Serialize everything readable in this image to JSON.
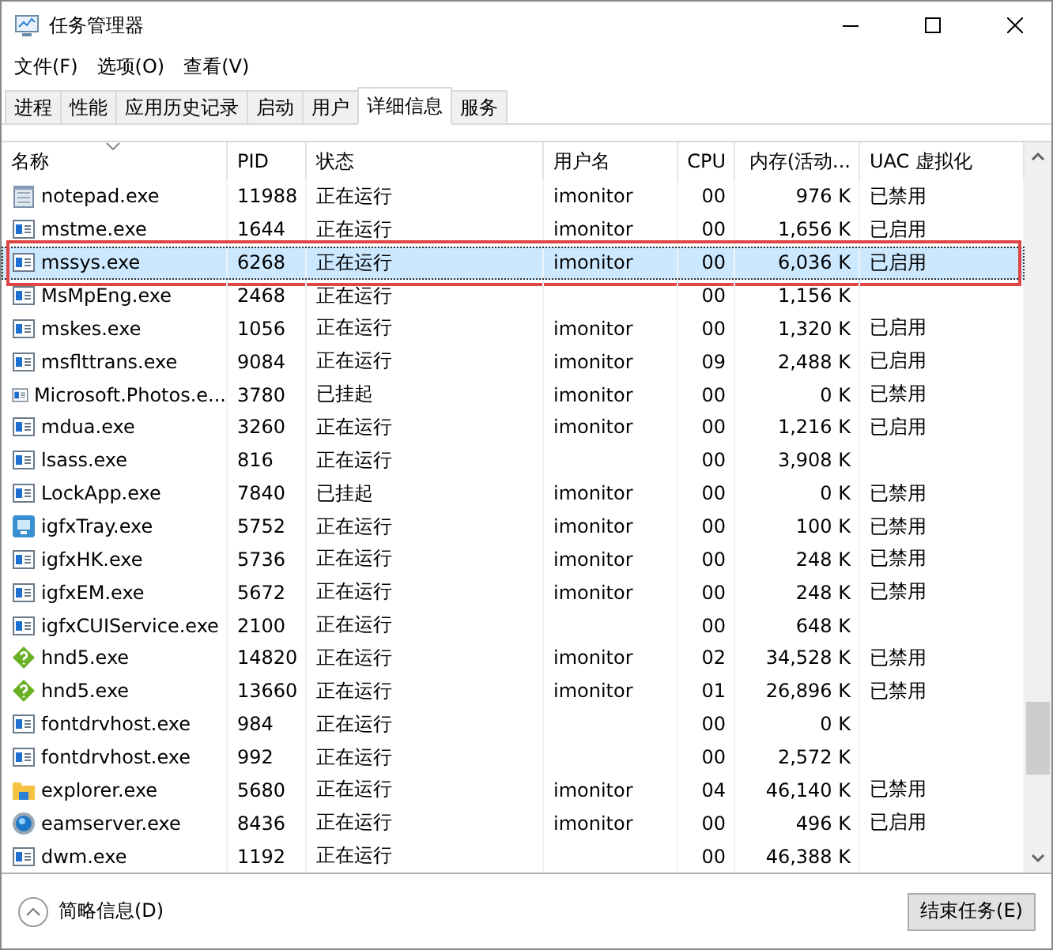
{
  "window": {
    "title": "任务管理器"
  },
  "menu": [
    "文件(F)",
    "选项(O)",
    "查看(V)"
  ],
  "tabs": [
    {
      "label": "进程",
      "selected": false
    },
    {
      "label": "性能",
      "selected": false
    },
    {
      "label": "应用历史记录",
      "selected": false
    },
    {
      "label": "启动",
      "selected": false
    },
    {
      "label": "用户",
      "selected": false
    },
    {
      "label": "详细信息",
      "selected": true
    },
    {
      "label": "服务",
      "selected": false
    }
  ],
  "table": {
    "columns": [
      "名称",
      "PID",
      "状态",
      "用户名",
      "CPU",
      "内存(活动...",
      "UAC 虚拟化"
    ],
    "rows": [
      {
        "kind": "notepad",
        "name": "notepad.exe",
        "pid": "11988",
        "status": "正在运行",
        "user": "imonitor",
        "cpu": "00",
        "memory": "976 K",
        "uac": "已禁用",
        "selected": false,
        "annotated": false
      },
      {
        "kind": "app",
        "name": "mstme.exe",
        "pid": "1644",
        "status": "正在运行",
        "user": "imonitor",
        "cpu": "00",
        "memory": "1,656 K",
        "uac": "已启用",
        "selected": false,
        "annotated": false
      },
      {
        "kind": "app",
        "name": "mssys.exe",
        "pid": "6268",
        "status": "正在运行",
        "user": "imonitor",
        "cpu": "00",
        "memory": "6,036 K",
        "uac": "已启用",
        "selected": true,
        "annotated": true
      },
      {
        "kind": "app",
        "name": "MsMpEng.exe",
        "pid": "2468",
        "status": "正在运行",
        "cpu": "00",
        "memory": "1,156 K",
        "selected": false,
        "annotated": false
      },
      {
        "kind": "app",
        "name": "mskes.exe",
        "pid": "1056",
        "status": "正在运行",
        "user": "imonitor",
        "cpu": "00",
        "memory": "1,320 K",
        "uac": "已启用",
        "selected": false,
        "annotated": false
      },
      {
        "kind": "app",
        "name": "msflttrans.exe",
        "pid": "9084",
        "status": "正在运行",
        "user": "imonitor",
        "cpu": "09",
        "memory": "2,488 K",
        "uac": "已启用",
        "selected": false,
        "annotated": false
      },
      {
        "kind": "app",
        "name": "Microsoft.Photos.e...",
        "pid": "3780",
        "status": "已挂起",
        "user": "imonitor",
        "cpu": "00",
        "memory": "0 K",
        "uac": "已禁用",
        "selected": false,
        "annotated": false
      },
      {
        "kind": "app",
        "name": "mdua.exe",
        "pid": "3260",
        "status": "正在运行",
        "user": "imonitor",
        "cpu": "00",
        "memory": "1,216 K",
        "uac": "已启用",
        "selected": false,
        "annotated": false
      },
      {
        "kind": "app",
        "name": "lsass.exe",
        "pid": "816",
        "status": "正在运行",
        "cpu": "00",
        "memory": "3,908 K",
        "selected": false,
        "annotated": false
      },
      {
        "kind": "app",
        "name": "LockApp.exe",
        "pid": "7840",
        "status": "已挂起",
        "user": "imonitor",
        "cpu": "00",
        "memory": "0 K",
        "uac": "已禁用",
        "selected": false,
        "annotated": false
      },
      {
        "kind": "tray",
        "name": "igfxTray.exe",
        "pid": "5752",
        "status": "正在运行",
        "user": "imonitor",
        "cpu": "00",
        "memory": "100 K",
        "uac": "已禁用",
        "selected": false,
        "annotated": false
      },
      {
        "kind": "app",
        "name": "igfxHK.exe",
        "pid": "5736",
        "status": "正在运行",
        "user": "imonitor",
        "cpu": "00",
        "memory": "248 K",
        "uac": "已禁用",
        "selected": false,
        "annotated": false
      },
      {
        "kind": "app",
        "name": "igfxEM.exe",
        "pid": "5672",
        "status": "正在运行",
        "user": "imonitor",
        "cpu": "00",
        "memory": "248 K",
        "uac": "已禁用",
        "selected": false,
        "annotated": false
      },
      {
        "kind": "app",
        "name": "igfxCUIService.exe",
        "pid": "2100",
        "status": "正在运行",
        "cpu": "00",
        "memory": "648 K",
        "selected": false,
        "annotated": false
      },
      {
        "kind": "diamond",
        "name": "hnd5.exe",
        "pid": "14820",
        "status": "正在运行",
        "user": "imonitor",
        "cpu": "02",
        "memory": "34,528 K",
        "uac": "已禁用",
        "selected": false,
        "annotated": false
      },
      {
        "kind": "diamond",
        "name": "hnd5.exe",
        "pid": "13660",
        "status": "正在运行",
        "user": "imonitor",
        "cpu": "01",
        "memory": "26,896 K",
        "uac": "已禁用",
        "selected": false,
        "annotated": false
      },
      {
        "kind": "app",
        "name": "fontdrvhost.exe",
        "pid": "984",
        "status": "正在运行",
        "cpu": "00",
        "memory": "0 K",
        "selected": false,
        "annotated": false
      },
      {
        "kind": "app",
        "name": "fontdrvhost.exe",
        "pid": "992",
        "status": "正在运行",
        "cpu": "00",
        "memory": "2,572 K",
        "selected": false,
        "annotated": false
      },
      {
        "kind": "folder",
        "name": "explorer.exe",
        "pid": "5680",
        "status": "正在运行",
        "user": "imonitor",
        "cpu": "04",
        "memory": "46,140 K",
        "uac": "已禁用",
        "selected": false,
        "annotated": false
      },
      {
        "kind": "orb",
        "name": "eamserver.exe",
        "pid": "8436",
        "status": "正在运行",
        "user": "imonitor",
        "cpu": "00",
        "memory": "496 K",
        "uac": "已启用",
        "selected": false,
        "annotated": false
      },
      {
        "kind": "app",
        "name": "dwm.exe",
        "pid": "1192",
        "status": "正在运行",
        "cpu": "00",
        "memory": "46,388 K",
        "selected": false,
        "annotated": false
      }
    ]
  },
  "footer": {
    "toggle": "简略信息(D)",
    "end_task": "结束任务(E)"
  }
}
